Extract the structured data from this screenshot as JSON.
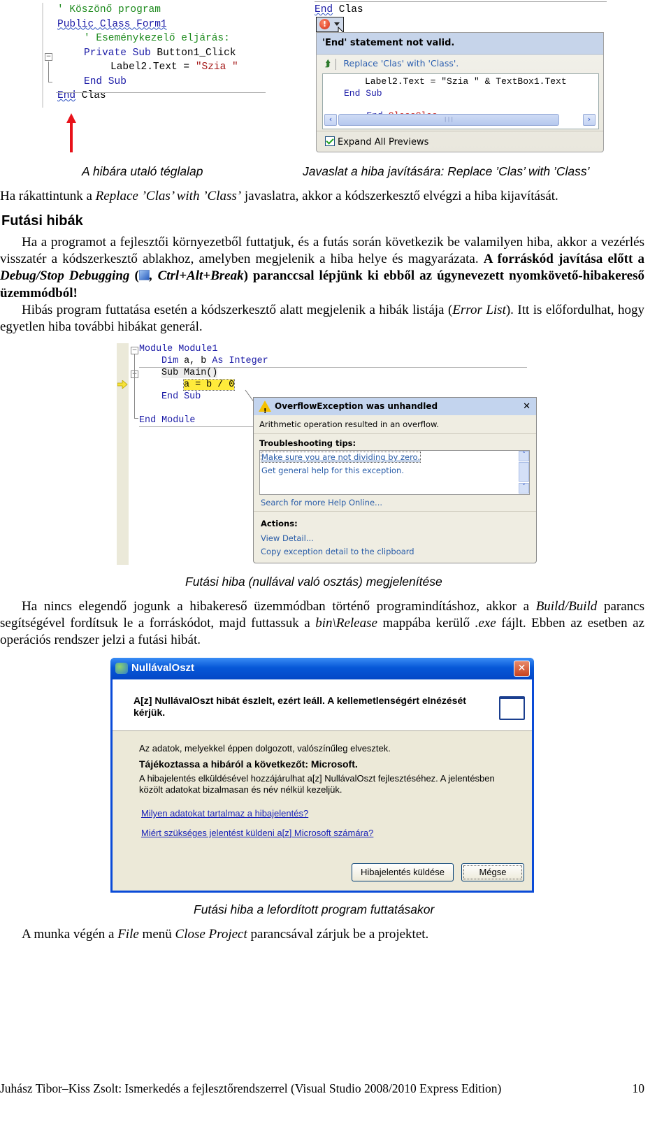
{
  "figure1": {
    "code_lines": [
      {
        "indent": 0,
        "parts": [
          {
            "t": "' Köszönő program",
            "c": "cm"
          }
        ]
      },
      {
        "indent": 0,
        "parts": [
          {
            "t": "Public Class Form1",
            "c": "kw squig"
          }
        ]
      },
      {
        "indent": 1,
        "parts": [
          {
            "t": "' Eseménykezelő eljárás:",
            "c": "cm"
          }
        ]
      },
      {
        "indent": 1,
        "parts": [
          {
            "t": "Private Sub ",
            "c": "kw"
          },
          {
            "t": "Button1_Click",
            "c": ""
          }
        ]
      },
      {
        "indent": 2,
        "parts": [
          {
            "t": "Label2.Text = ",
            "c": ""
          },
          {
            "t": "\"Szia \"",
            "c": "str"
          }
        ]
      },
      {
        "indent": 1,
        "parts": [
          {
            "t": "End Sub",
            "c": "kw"
          }
        ]
      },
      {
        "indent": 0,
        "parts": [
          {
            "t": "End",
            "c": "kw squig"
          },
          {
            "t": " Clas",
            "c": ""
          }
        ]
      }
    ],
    "caption": "A hibára utaló téglalap"
  },
  "figure2": {
    "top_code_kw": "End",
    "top_code_rest": " Clas",
    "error_header": "'End' statement not valid.",
    "suggestion": "Replace 'Clas' with 'Class'.",
    "preview_line1": "Label2.Text = \"Szia \" & TextBox1.Text",
    "preview_line2_kw": "End Sub",
    "preview_line3_kw": "End",
    "preview_line3_new": "Class",
    "preview_line3_old": "Clas",
    "expand_label": "Expand All Previews",
    "expand_checked": true,
    "caption": "Javaslat a hiba javítására: Replace ’Clas’ with ’Class’"
  },
  "text": {
    "p1_a": "Ha rákattintunk a ",
    "p1_i": "Replace ’Clas’ with ’Class’",
    "p1_b": " javaslatra, akkor a kódszerkesztő elvégzi a hiba kijavítását.",
    "heading": "Futási hibák",
    "p2_a": "Ha a programot a fejlesztői környezetből futtatjuk, és a futás során következik be valamilyen hiba, akkor a vezérlés visszatér a kódszerkesztő ablakhoz, amelyben megjelenik a hiba helye és magyarázata. ",
    "p2_b1": "A forráskód javítása előtt a ",
    "p2_bi1": "Debug/Stop Debugging",
    "p2_b2": " (",
    "p2_bi2": ", Ctrl+Alt+Break",
    "p2_b3": ") paranccsal lépjünk ki ebből az úgynevezett nyomkövető-hibakereső üzemmódból!",
    "p3_a": "Hibás program futtatása esetén a kódszerkesztő alatt megjelenik a hibák listája (",
    "p3_i": "Error List",
    "p3_b": "). Itt is előfordulhat, hogy egyetlen hiba további hibákat generál.",
    "caption3": "Futási hiba (nullával való osztás) megjelenítése",
    "p4_a": "Ha nincs elegendő jogunk a hibakereső üzemmódban történő programindításhoz, akkor a ",
    "p4_i1": "Build/Build",
    "p4_b": " parancs segítségével fordítsuk le a forráskódot, majd futtassuk a ",
    "p4_i2": "bin\\Release",
    "p4_c": " mappába kerülő ",
    "p4_i3": ".exe",
    "p4_d": " fájlt. Ebben az esetben az operációs rendszer jelzi a futási hibát.",
    "caption4": "Futási hiba a lefordított program futtatásakor",
    "p5_a": "A munka végén a ",
    "p5_i1": "File",
    "p5_b": " menü ",
    "p5_i2": "Close Project",
    "p5_c": " parancsával zárjuk be a projektet."
  },
  "figure3": {
    "l1_kw": "Module",
    "l1_rest": " Module1",
    "l2_kw1": "Dim",
    "l2_mid": " a, b ",
    "l2_kw2": "As",
    "l2_kw3": " Integer",
    "l3_kw": "Sub",
    "l3_rest": " Main()",
    "l4": "a = b / 0",
    "l5": "End Sub",
    "l6": "End Module",
    "exception_title": "OverflowException was unhandled",
    "exception_message": "Arithmetic operation resulted in an overflow.",
    "tips_label": "Troubleshooting tips:",
    "tips": [
      "Make sure you are not dividing by zero.",
      "Get general help for this exception."
    ],
    "search_link": "Search for more Help Online...",
    "actions_label": "Actions:",
    "actions": [
      "View Detail...",
      "Copy exception detail to the clipboard"
    ]
  },
  "figure4": {
    "window_title": "NullávalOszt",
    "main_message": "A[z] NullávalOszt hibát észlelt, ezért leáll. A kellemetlenségért elnézését kérjük.",
    "data_lost": "Az adatok, melyekkel éppen dolgozott, valószínűleg elvesztek.",
    "inform_heading": "Tájékoztassa a hibáról a következőt: Microsoft.",
    "inform_text": "A hibajelentés elküldésével hozzájárulhat a[z] NullávalOszt fejlesztéséhez. A jelentésben közölt adatokat bizalmasan és név nélkül kezeljük.",
    "link1": "Milyen adatokat tartalmaz a hibajelentés?",
    "link2": "Miért szükséges jelentést küldeni a[z] Microsoft számára?",
    "send_button": "Hibajelentés küldése",
    "cancel_button": "Mégse"
  },
  "footer": {
    "citation": "Juhász Tibor–Kiss Zsolt: Ismerkedés a fejlesztőrendszerrel (Visual Studio 2008/2010 Express Edition)",
    "page_number": "10"
  }
}
